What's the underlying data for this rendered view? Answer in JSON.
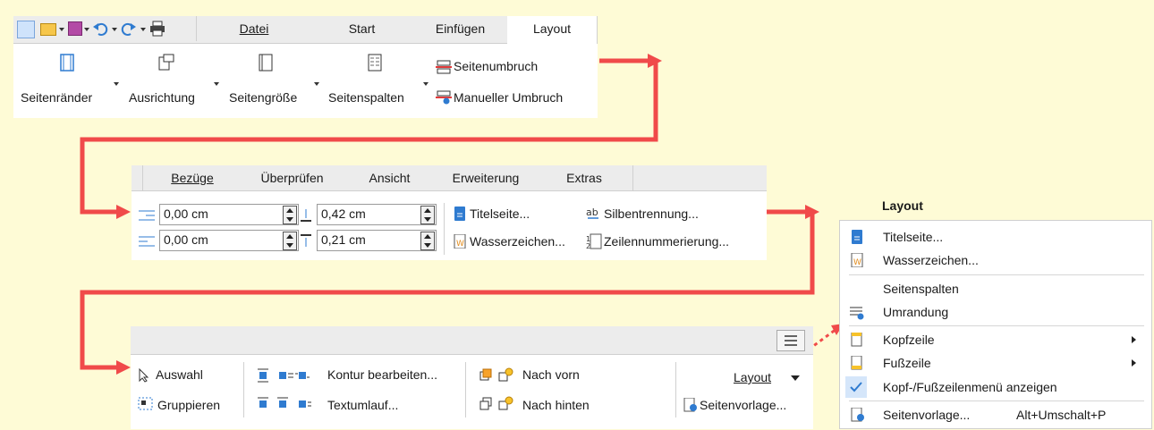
{
  "panel1": {
    "quick_tools": [
      "new-window-icon",
      "open-icon",
      "save-icon",
      "undo-icon",
      "redo-icon",
      "print-icon"
    ],
    "tabs": [
      "Datei",
      "Start",
      "Einfügen",
      "Layout"
    ],
    "buttons": {
      "margins": "Seitenränder",
      "orientation": "Ausrichtung",
      "size": "Seitengröße",
      "columns": "Seitenspalten",
      "page_break": "Seitenumbruch",
      "manual_break": "Manueller Umbruch"
    }
  },
  "panel2": {
    "tabs": [
      "Bezüge",
      "Überprüfen",
      "Ansicht",
      "Erweiterung",
      "Extras"
    ],
    "spin1": "0,00 cm",
    "spin2": "0,42 cm",
    "spin3": "0,00 cm",
    "spin4": "0,21 cm",
    "title_page": "Titelseite...",
    "hyphenation": "Silbentrennung...",
    "watermark": "Wasserzeichen...",
    "line_numbering": "Zeilennummerierung..."
  },
  "panel3": {
    "select": "Auswahl",
    "group": "Gruppieren",
    "contour": "Kontur bearbeiten...",
    "wrap": "Textumlauf...",
    "front": "Nach vorn",
    "back": "Nach hinten",
    "layout": "Layout",
    "page_style": "Seitenvorlage..."
  },
  "menu": {
    "title": "Layout",
    "items": [
      {
        "label": "Titelseite...",
        "icon": "title-page-icon"
      },
      {
        "label": "Wasserzeichen...",
        "icon": "watermark-icon"
      },
      {
        "label": "Seitenspalten",
        "icon": ""
      },
      {
        "label": "Umrandung",
        "icon": "border-icon"
      },
      {
        "label": "Kopfzeile",
        "icon": "header-icon"
      },
      {
        "label": "Fußzeile",
        "icon": "footer-icon"
      },
      {
        "label": "Kopf-/Fußzeilenmenü anzeigen",
        "icon": "check-icon"
      },
      {
        "label": "Seitenvorlage...",
        "icon": "page-style-icon",
        "shortcut": "Alt+Umschalt+P"
      }
    ]
  },
  "colors": {
    "arrow": "#f04a4a",
    "background": "#fefbd6",
    "accent": "#2f7bd0"
  }
}
